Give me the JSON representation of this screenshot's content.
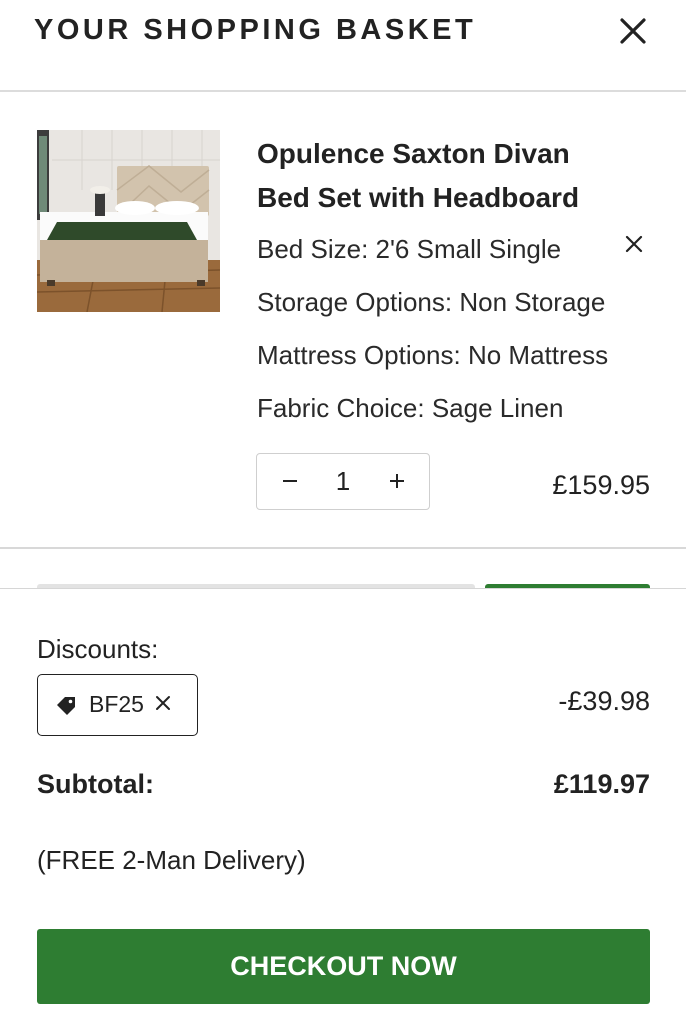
{
  "header": {
    "title": "YOUR SHOPPING BASKET",
    "close_icon": "close-icon"
  },
  "item": {
    "title": "Opulence Saxton Divan Bed Set with Headboard",
    "image": "bed-product-image",
    "options": [
      "Bed Size: 2'6 Small Single",
      "Storage Options: Non Storage",
      "Mattress Options: No Mattress",
      "Fabric Choice: Sage Linen"
    ],
    "quantity": "1",
    "decrease_icon": "minus-icon",
    "increase_icon": "plus-icon",
    "price": "£159.95"
  },
  "summary": {
    "discounts_label": "Discounts:",
    "coupon": {
      "code": "BF25",
      "icon": "tag-icon"
    },
    "discount_amount": "-£39.98",
    "subtotal_label": "Subtotal:",
    "subtotal_value": "£119.97",
    "delivery_note": "(FREE 2-Man Delivery)"
  },
  "checkout_label": "CHECKOUT NOW",
  "colors": {
    "accent": "#2e7d32",
    "text": "#222222",
    "divider": "#d8d8d8"
  }
}
